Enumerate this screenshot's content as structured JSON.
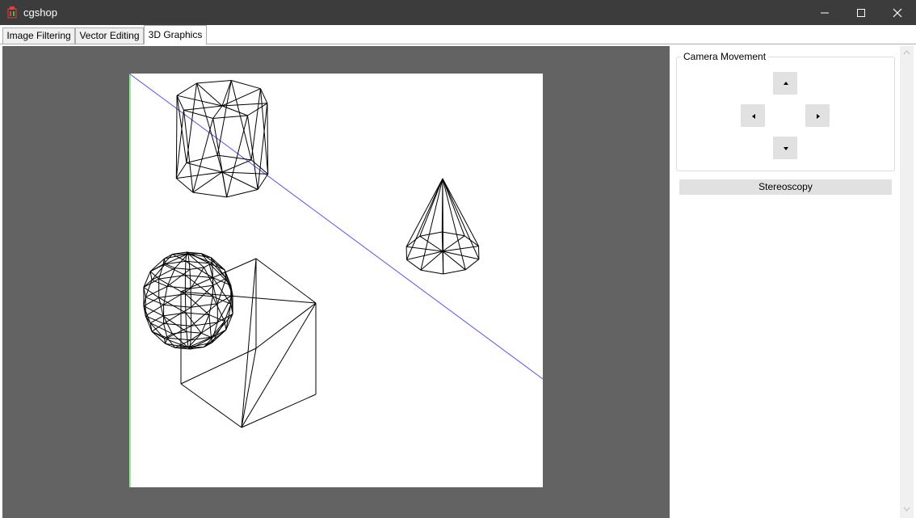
{
  "window": {
    "title": "cgshop"
  },
  "tabs": [
    {
      "label": "Image Filtering"
    },
    {
      "label": "Vector Editing"
    },
    {
      "label": "3D Graphics"
    }
  ],
  "active_tab": "3D Graphics",
  "viewport": {
    "background_color": "#636363",
    "canvas_color": "#ffffff",
    "axis_colors": {
      "x": "#5555ee",
      "y": "#33dd33"
    },
    "objects": [
      "cylinder",
      "cone",
      "sphere",
      "cube"
    ]
  },
  "side_panel": {
    "camera_group_label": "Camera Movement",
    "camera_buttons": [
      "up-arrow-icon",
      "left-arrow-icon",
      "right-arrow-icon",
      "down-arrow-icon"
    ],
    "stereoscopy_label": "Stereoscopy"
  },
  "colors": {
    "titlebar": "#3c3c3c",
    "button": "#e1e1e1",
    "wireframe": "#000000"
  }
}
